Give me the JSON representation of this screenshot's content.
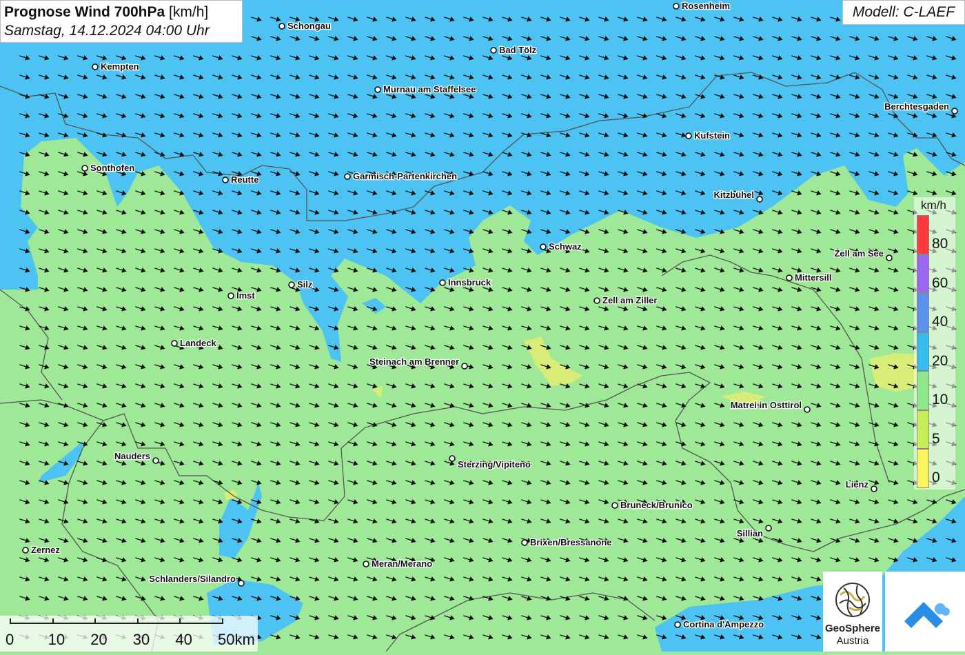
{
  "title": {
    "main": "Prognose Wind 700hPa",
    "unit": "[km/h]",
    "date": "Samstag, 14.12.2024 04:00 Uhr"
  },
  "model_label": "Modell: C-LAEF",
  "legend": {
    "unit": "km/h",
    "levels": [
      {
        "label": "80",
        "color": "#ff3a3a"
      },
      {
        "label": "60",
        "color": "#9b66f0"
      },
      {
        "label": "40",
        "color": "#5a92ee"
      },
      {
        "label": "20",
        "color": "#36bdf0"
      },
      {
        "label": "10",
        "color": "#8ee88a"
      },
      {
        "label": "5",
        "color": "#c8ee55"
      },
      {
        "label": "0",
        "color": "#fff55a"
      }
    ]
  },
  "scale_bar": {
    "labels": [
      "0",
      "10",
      "20",
      "30",
      "40",
      "50km"
    ]
  },
  "wind_direction": "west-north-west flow, arrows pointing east-south-east",
  "cities": [
    {
      "name": "Rosenheim"
    },
    {
      "name": "Schongau"
    },
    {
      "name": "Bad Tölz"
    },
    {
      "name": "Kempten"
    },
    {
      "name": "Murnau am Staffelsee"
    },
    {
      "name": "Berchtesgaden"
    },
    {
      "name": "Kufstein"
    },
    {
      "name": "Sonthofen"
    },
    {
      "name": "Reutte"
    },
    {
      "name": "Garmisch-Partenkirchen"
    },
    {
      "name": "Kitzbühel"
    },
    {
      "name": "Schwaz"
    },
    {
      "name": "Zell am See"
    },
    {
      "name": "Mittersill"
    },
    {
      "name": "Silz"
    },
    {
      "name": "Innsbruck"
    },
    {
      "name": "Imst"
    },
    {
      "name": "Zell am Ziller"
    },
    {
      "name": "Landeck"
    },
    {
      "name": "Steinach am Brenner"
    },
    {
      "name": "Matrei in Osttirol"
    },
    {
      "name": "Nauders"
    },
    {
      "name": "Sterzing/Vipiteno"
    },
    {
      "name": "Lienz"
    },
    {
      "name": "Bruneck/Brunico"
    },
    {
      "name": "Sillian"
    },
    {
      "name": "Brixen/Bressanone"
    },
    {
      "name": "Zernez"
    },
    {
      "name": "Meran/Merano"
    },
    {
      "name": "Schlanders/Silandro"
    },
    {
      "name": "Cortina d'Ampezzo"
    }
  ],
  "logos": {
    "geosphere_line1": "GeoSphere",
    "geosphere_line2": "Austria"
  }
}
